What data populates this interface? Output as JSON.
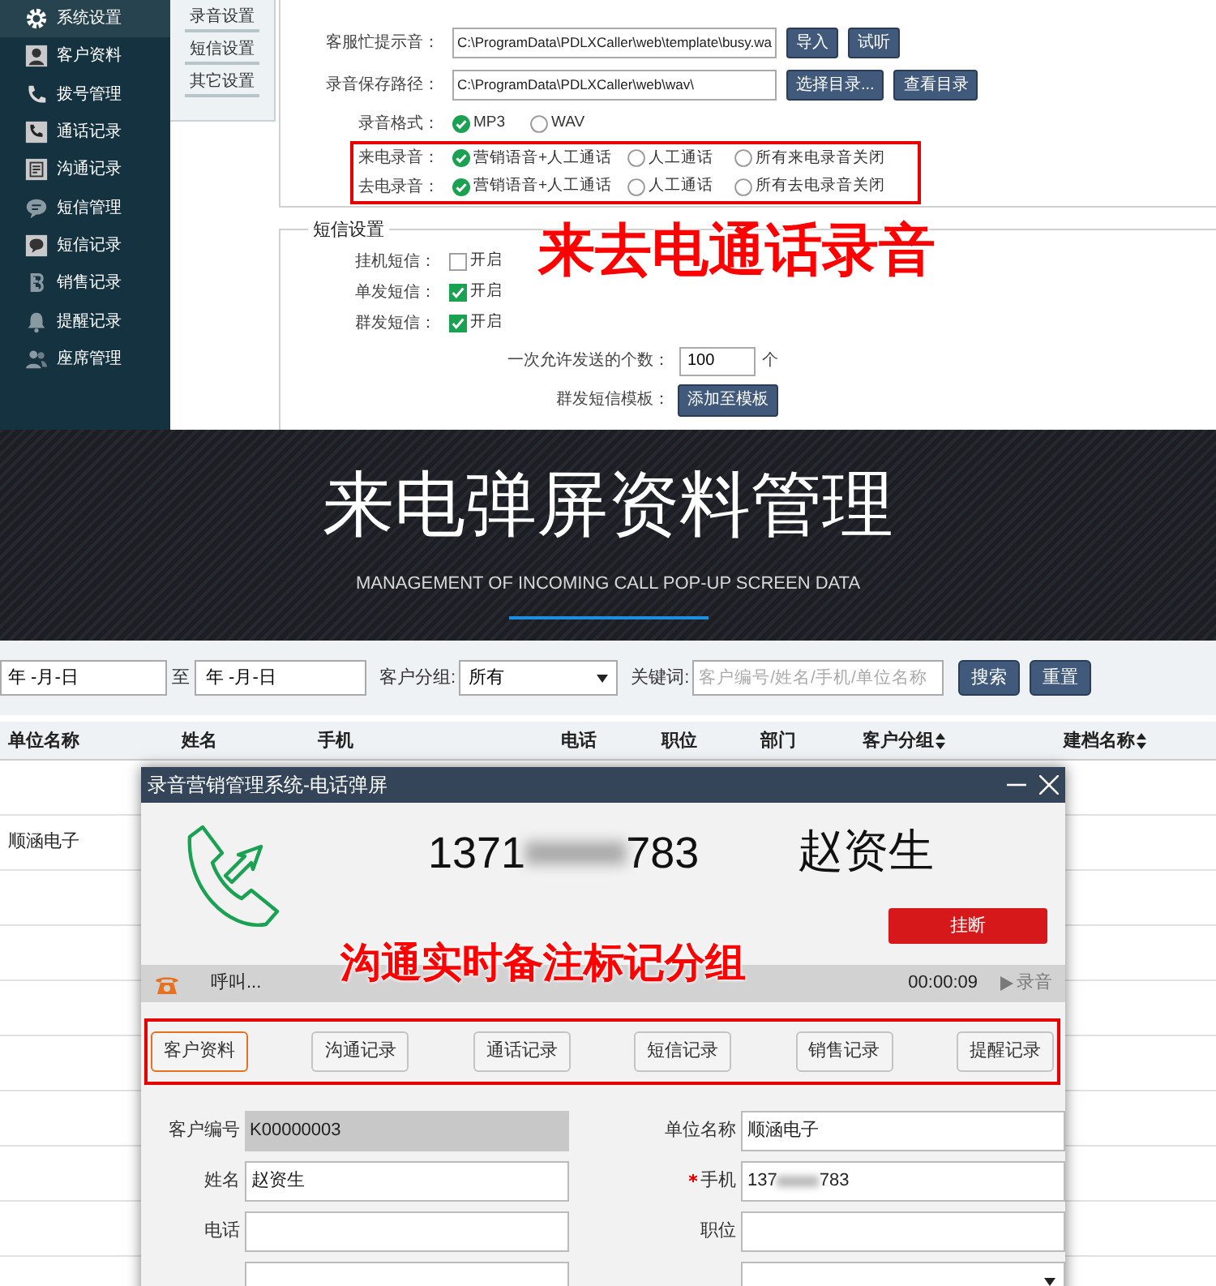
{
  "settings_screen": {
    "sidebar": [
      {
        "label": "系统设置",
        "selected": true
      },
      {
        "label": "客户资料",
        "selected": false
      },
      {
        "label": "拨号管理",
        "selected": false
      },
      {
        "label": "通话记录",
        "selected": false
      },
      {
        "label": "沟通记录",
        "selected": false
      },
      {
        "label": "短信管理",
        "selected": false
      },
      {
        "label": "短信记录",
        "selected": false
      },
      {
        "label": "销售记录",
        "selected": false
      },
      {
        "label": "提醒记录",
        "selected": false
      },
      {
        "label": "座席管理",
        "selected": false
      }
    ],
    "submenu": [
      "录音设置",
      "短信设置",
      "其它设置"
    ],
    "path_rows": [
      {
        "label": "客服忙提示音：",
        "value": "C:\\ProgramData\\PDLXCaller\\web\\template\\busy.wa",
        "buttons": [
          "导入",
          "试听"
        ]
      },
      {
        "label": "录音保存路径：",
        "value": "C:\\ProgramData\\PDLXCaller\\web\\wav\\",
        "buttons": [
          "选择目录...",
          "查看目录"
        ]
      }
    ],
    "format": {
      "label": "录音格式：",
      "options": [
        {
          "label": "MP3",
          "selected": true
        },
        {
          "label": "WAV",
          "selected": false
        }
      ]
    },
    "recording_rows": [
      {
        "label": "来电录音：",
        "options": [
          {
            "label": "营销语音+人工通话",
            "selected": true
          },
          {
            "label": "人工通话",
            "selected": false
          },
          {
            "label": "所有来电录音关闭",
            "selected": false
          }
        ]
      },
      {
        "label": "去电录音：",
        "options": [
          {
            "label": "营销语音+人工通话",
            "selected": true
          },
          {
            "label": "人工通话",
            "selected": false
          },
          {
            "label": "所有去电录音关闭",
            "selected": false
          }
        ]
      }
    ],
    "sms_section": {
      "title": "短信设置",
      "toggles": [
        {
          "label": "挂机短信：",
          "option": "开启",
          "checked": false
        },
        {
          "label": "单发短信：",
          "option": "开启",
          "checked": true
        },
        {
          "label": "群发短信：",
          "option": "开启",
          "checked": true
        }
      ],
      "count": {
        "label": "一次允许发送的个数：",
        "value": "100",
        "unit": "个"
      },
      "template": {
        "label": "群发短信模板：",
        "button": "添加至模板"
      }
    },
    "annotation": "来去电通话录音"
  },
  "banner": {
    "title": "来电弹屏资料管理",
    "subtitle": "MANAGEMENT OF INCOMING CALL POP-UP SCREEN DATA"
  },
  "customer_screen": {
    "filters": {
      "date_from": "年 -月-日",
      "separator": "至",
      "date_to": "年 -月-日",
      "group_label": "客户分组:",
      "group_value": "所有",
      "keyword_label": "关键词:",
      "keyword_placeholder": "客户编号/姓名/手机/单位名称",
      "buttons": [
        "搜索",
        "重置"
      ]
    },
    "table": {
      "columns": [
        {
          "label": "单位名称",
          "sortable": false
        },
        {
          "label": "姓名",
          "sortable": false
        },
        {
          "label": "手机",
          "sortable": false
        },
        {
          "label": "电话",
          "sortable": false
        },
        {
          "label": "职位",
          "sortable": false
        },
        {
          "label": "部门",
          "sortable": false
        },
        {
          "label": "客户分组",
          "sortable": true
        },
        {
          "label": "建档名称",
          "sortable": true
        }
      ],
      "visible_cells": [
        "顺涵电子"
      ]
    },
    "popup": {
      "title": "录音营销管理系统-电话弹屏",
      "number_start": "1371",
      "number_end": "783",
      "caller_name": "赵资生",
      "hangup_button": "挂断",
      "status": "呼叫...",
      "timer": "00:00:09",
      "record_button": {
        "label": "录音",
        "disabled": true
      },
      "tabs": [
        {
          "label": "客户资料",
          "selected": true
        },
        {
          "label": "沟通记录",
          "selected": false
        },
        {
          "label": "通话记录",
          "selected": false
        },
        {
          "label": "短信记录",
          "selected": false
        },
        {
          "label": "销售记录",
          "selected": false
        },
        {
          "label": "提醒记录",
          "selected": false
        }
      ],
      "fields": [
        {
          "label": "客户编号",
          "value": "K00000003",
          "kind": "readonly",
          "required": false
        },
        {
          "label": "单位名称",
          "value": "顺涵电子",
          "kind": "text",
          "required": false
        },
        {
          "label": "姓名",
          "value": "赵资生",
          "kind": "text",
          "required": false
        },
        {
          "label": "手机",
          "value_start": "137",
          "value_end": "783",
          "kind": "masked",
          "required": true
        },
        {
          "label": "电话",
          "kind": "text",
          "required": false
        },
        {
          "label": "职位",
          "kind": "text",
          "required": false
        },
        {
          "kind": "text"
        },
        {
          "kind": "select"
        }
      ],
      "annotation": "沟通实时备注标记分组"
    }
  }
}
